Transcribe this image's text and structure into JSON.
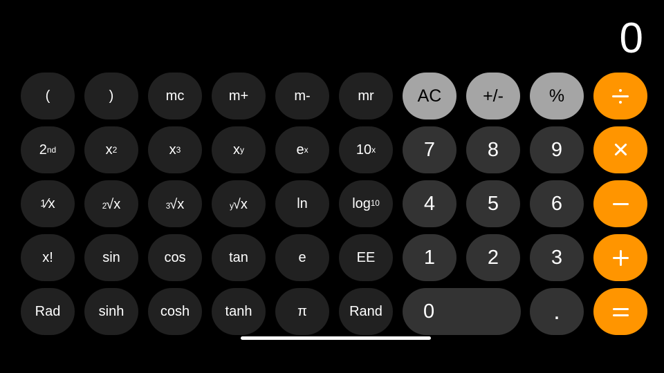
{
  "app": {
    "name": "Calculator",
    "mode": "scientific-landscape",
    "background_color": "#000000"
  },
  "display": {
    "value": "0"
  },
  "colors": {
    "function_key": "#212121",
    "number_key": "#333333",
    "utility_key": "#a5a5a5",
    "operator_key": "#ff9500",
    "text_light": "#ffffff",
    "text_dark": "#000000",
    "home_indicator": "#ffffff"
  },
  "keypad": {
    "rows": [
      {
        "keys": [
          {
            "name": "open-paren",
            "label": "(",
            "kind": "fn"
          },
          {
            "name": "close-paren",
            "label": ")",
            "kind": "fn"
          },
          {
            "name": "memory-clear",
            "label": "mc",
            "kind": "fn"
          },
          {
            "name": "memory-add",
            "label": "m+",
            "kind": "fn"
          },
          {
            "name": "memory-subtract",
            "label": "m-",
            "kind": "fn"
          },
          {
            "name": "memory-recall",
            "label": "mr",
            "kind": "fn"
          },
          {
            "name": "all-clear",
            "label": "AC",
            "kind": "util"
          },
          {
            "name": "sign-toggle",
            "label": "+/-",
            "kind": "util"
          },
          {
            "name": "percent",
            "label": "%",
            "kind": "util"
          },
          {
            "name": "divide",
            "label": "÷",
            "kind": "op"
          }
        ]
      },
      {
        "keys": [
          {
            "name": "second-function",
            "label": "2nd",
            "kind": "fn"
          },
          {
            "name": "square",
            "label": "x²",
            "kind": "fn"
          },
          {
            "name": "cube",
            "label": "x³",
            "kind": "fn"
          },
          {
            "name": "power-y",
            "label": "xʸ",
            "kind": "fn"
          },
          {
            "name": "e-power-x",
            "label": "eˣ",
            "kind": "fn"
          },
          {
            "name": "ten-power-x",
            "label": "10ˣ",
            "kind": "fn"
          },
          {
            "name": "digit-7",
            "label": "7",
            "kind": "num"
          },
          {
            "name": "digit-8",
            "label": "8",
            "kind": "num"
          },
          {
            "name": "digit-9",
            "label": "9",
            "kind": "num"
          },
          {
            "name": "multiply",
            "label": "×",
            "kind": "op"
          }
        ]
      },
      {
        "keys": [
          {
            "name": "reciprocal",
            "label": "1/x",
            "kind": "fn"
          },
          {
            "name": "square-root",
            "label": "²√x",
            "kind": "fn"
          },
          {
            "name": "cube-root",
            "label": "³√x",
            "kind": "fn"
          },
          {
            "name": "nth-root",
            "label": "ʸ√x",
            "kind": "fn"
          },
          {
            "name": "natural-log",
            "label": "ln",
            "kind": "fn"
          },
          {
            "name": "log-base-10",
            "label": "log10",
            "kind": "fn"
          },
          {
            "name": "digit-4",
            "label": "4",
            "kind": "num"
          },
          {
            "name": "digit-5",
            "label": "5",
            "kind": "num"
          },
          {
            "name": "digit-6",
            "label": "6",
            "kind": "num"
          },
          {
            "name": "subtract",
            "label": "−",
            "kind": "op"
          }
        ]
      },
      {
        "keys": [
          {
            "name": "factorial",
            "label": "x!",
            "kind": "fn"
          },
          {
            "name": "sine",
            "label": "sin",
            "kind": "fn"
          },
          {
            "name": "cosine",
            "label": "cos",
            "kind": "fn"
          },
          {
            "name": "tangent",
            "label": "tan",
            "kind": "fn"
          },
          {
            "name": "euler-constant",
            "label": "e",
            "kind": "fn"
          },
          {
            "name": "exponent-entry",
            "label": "EE",
            "kind": "fn"
          },
          {
            "name": "digit-1",
            "label": "1",
            "kind": "num"
          },
          {
            "name": "digit-2",
            "label": "2",
            "kind": "num"
          },
          {
            "name": "digit-3",
            "label": "3",
            "kind": "num"
          },
          {
            "name": "add",
            "label": "+",
            "kind": "op"
          }
        ]
      },
      {
        "keys": [
          {
            "name": "radian-mode",
            "label": "Rad",
            "kind": "fn"
          },
          {
            "name": "hyperbolic-sine",
            "label": "sinh",
            "kind": "fn"
          },
          {
            "name": "hyperbolic-cosine",
            "label": "cosh",
            "kind": "fn"
          },
          {
            "name": "hyperbolic-tangent",
            "label": "tanh",
            "kind": "fn"
          },
          {
            "name": "pi-constant",
            "label": "π",
            "kind": "fn"
          },
          {
            "name": "random-number",
            "label": "Rand",
            "kind": "fn"
          },
          {
            "name": "digit-0",
            "label": "0",
            "kind": "num"
          },
          {
            "name": "decimal-point",
            "label": ".",
            "kind": "num"
          },
          {
            "name": "equals",
            "label": "=",
            "kind": "op"
          }
        ]
      }
    ]
  },
  "labels": {
    "second_base": "2",
    "second_sup": "nd",
    "x_base": "x",
    "sup_2": "2",
    "sup_3": "3",
    "sup_y": "y",
    "e_base": "e",
    "sup_x": "x",
    "ten_base": "10",
    "recip_num": "1",
    "recip_slash": "⁄",
    "recip_den": "x",
    "root_idx_2": "2",
    "root_idx_3": "3",
    "root_idx_y": "y",
    "root_sign": "√x",
    "log_base": "log",
    "log_sub": "10"
  }
}
